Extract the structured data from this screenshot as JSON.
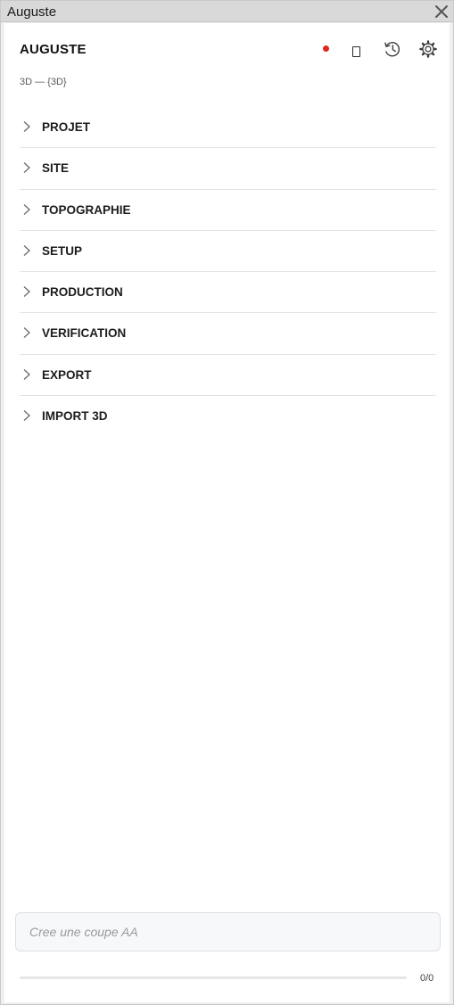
{
  "window": {
    "title": "Auguste",
    "close_icon": "close-icon"
  },
  "header": {
    "app_title": "AUGUSTE",
    "subtitle": "3D — {3D}",
    "status_dot_color": "#e0281f",
    "tools": [
      "status-dot",
      "document-icon",
      "history-icon",
      "gear-icon"
    ]
  },
  "sections": [
    {
      "label": "PROJET",
      "icon": "chevron-right-icon"
    },
    {
      "label": "SITE",
      "icon": "chevron-right-icon"
    },
    {
      "label": "TOPOGRAPHIE",
      "icon": "chevron-right-icon"
    },
    {
      "label": "SETUP",
      "icon": "chevron-right-icon"
    },
    {
      "label": "PRODUCTION",
      "icon": "chevron-right-icon"
    },
    {
      "label": "VERIFICATION",
      "icon": "chevron-right-icon"
    },
    {
      "label": "EXPORT",
      "icon": "chevron-right-icon"
    },
    {
      "label": "IMPORT 3D",
      "icon": "chevron-right-icon"
    }
  ],
  "prompt": {
    "placeholder": "Cree une coupe AA",
    "value": ""
  },
  "progress": {
    "fraction": 0,
    "count_text": "0/0"
  }
}
